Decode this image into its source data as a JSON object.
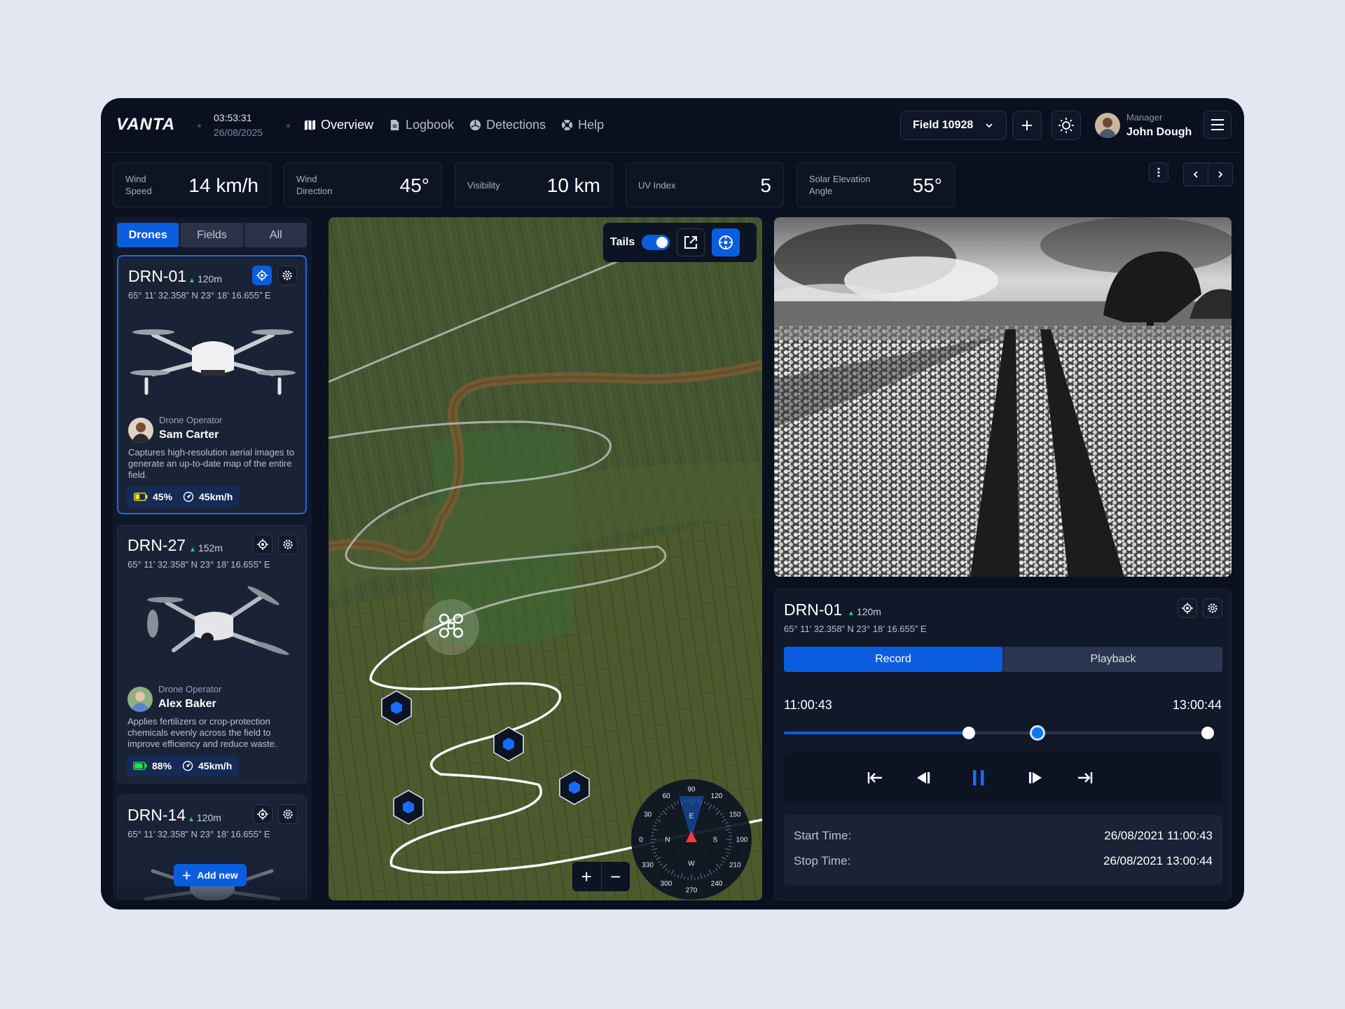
{
  "app": {
    "logo": "VANTA",
    "time": "03:53:31",
    "date": "26/08/2025"
  },
  "nav": [
    {
      "label": "Overview",
      "icon": "map-icon",
      "active": true
    },
    {
      "label": "Logbook",
      "icon": "document-icon",
      "active": false
    },
    {
      "label": "Detections",
      "icon": "radar-icon",
      "active": false
    },
    {
      "label": "Help",
      "icon": "help-icon",
      "active": false
    }
  ],
  "header": {
    "field": "Field 10928",
    "user_role": "Manager",
    "user_name": "John Dough"
  },
  "stats": [
    {
      "label1": "Wind",
      "label2": "Speed",
      "value": "14 km/h"
    },
    {
      "label1": "Wind",
      "label2": "Direction",
      "value": "45°"
    },
    {
      "label1": "Visibility",
      "label2": "",
      "value": "10 km"
    },
    {
      "label1": "UV Index",
      "label2": "",
      "value": "5"
    },
    {
      "label1": "Solar Elevation",
      "label2": "Angle",
      "value": "55°"
    }
  ],
  "tabs": [
    "Drones",
    "Fields",
    "All"
  ],
  "drones": [
    {
      "id": "DRN-01",
      "altitude": "120m",
      "coords": "65° 11’ 32.358” N 23° 18’ 16.655” E",
      "operator_role": "Drone Operator",
      "operator": "Sam Carter",
      "description": "Captures high-resolution aerial images to generate an up-to-date map of the entire field.",
      "battery": "45%",
      "battery_level": 0.45,
      "speed": "45km/h"
    },
    {
      "id": "DRN-27",
      "altitude": "152m",
      "coords": "65° 11’ 32.358” N 23° 18’ 16.655” E",
      "operator_role": "Drone Operator",
      "operator": "Alex Baker",
      "description": "Applies fertilizers or crop-protection chemicals evenly across the field to improve efficiency and reduce waste.",
      "battery": "88%",
      "battery_level": 0.88,
      "speed": "45km/h"
    },
    {
      "id": "DRN-14",
      "altitude": "120m",
      "coords": "65° 11’ 32.358” N 23° 18’ 16.655” E"
    }
  ],
  "add_new": "Add new",
  "map": {
    "tails_label": "Tails",
    "tails_on": true,
    "zoom_in": "+",
    "zoom_out": "−",
    "compass": {
      "outer": [
        "90",
        "120",
        "150",
        "100",
        "210",
        "240",
        "270",
        "300",
        "330",
        "0",
        "30",
        "60"
      ],
      "inner": [
        "E",
        "S",
        "W",
        "N"
      ]
    }
  },
  "control": {
    "id": "DRN-01",
    "altitude": "120m",
    "coords": "65° 11’ 32.358” N 23° 18’ 16.655” E",
    "tabs": [
      "Record",
      "Playback"
    ],
    "time_start": "11:00:43",
    "time_end": "13:00:44",
    "progress": 0.43,
    "cursor": 0.59,
    "start_label": "Start Time:",
    "start_value": "26/08/2021 11:00:43",
    "stop_label": "Stop Time:",
    "stop_value": "26/08/2021 13:00:44"
  }
}
